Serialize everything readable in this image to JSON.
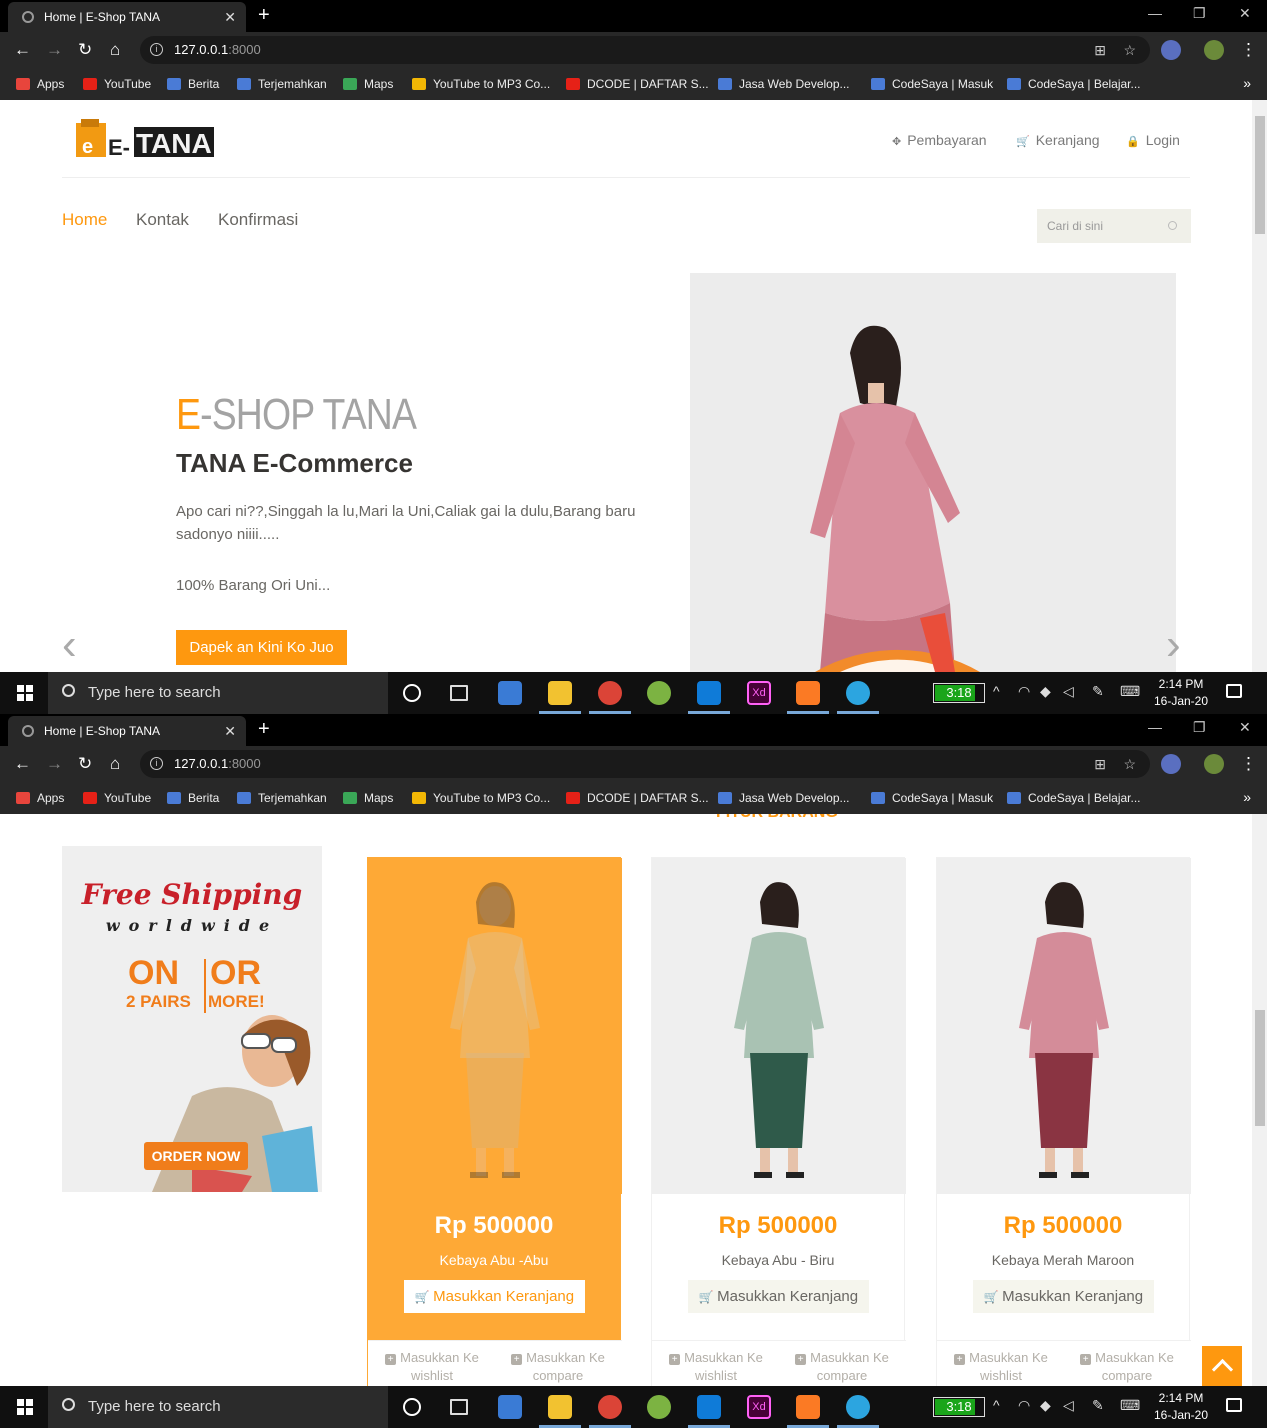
{
  "browser": {
    "tab_title": "Home | E-Shop TANA",
    "tab_close": "✕",
    "new_tab": "+",
    "url_host": "127.0.0.1",
    "url_port": ":8000",
    "bookmarks": [
      {
        "label": "Apps",
        "color": "#e8453c"
      },
      {
        "label": "YouTube",
        "color": "#e62117"
      },
      {
        "label": "Berita",
        "color": "#4a7bd6"
      },
      {
        "label": "Terjemahkan",
        "color": "#4a7bd6"
      },
      {
        "label": "Maps",
        "color": "#3aa757"
      },
      {
        "label": "YouTube to MP3 Co...",
        "color": "#f2b705"
      },
      {
        "label": "DCODE | DAFTAR S...",
        "color": "#e62117"
      },
      {
        "label": "Jasa Web Develop...",
        "color": "#4a7bd6"
      },
      {
        "label": "CodeSaya | Masuk",
        "color": "#4a7bd6"
      },
      {
        "label": "CodeSaya | Belajar...",
        "color": "#4a7bd6"
      }
    ],
    "more": "»"
  },
  "header": {
    "links": [
      {
        "icon": "crosshair-icon",
        "glyph": "✥",
        "label": "Pembayaran"
      },
      {
        "icon": "cart-icon",
        "glyph": "🛒",
        "label": "Keranjang"
      },
      {
        "icon": "lock-icon",
        "glyph": "🔒",
        "label": "Login"
      }
    ],
    "nav": [
      {
        "label": "Home",
        "active": true
      },
      {
        "label": "Kontak",
        "active": false
      },
      {
        "label": "Konfirmasi",
        "active": false
      }
    ],
    "search_placeholder": "Cari di sini"
  },
  "hero": {
    "title_e": "E",
    "title_rest": "-SHOP TANA",
    "subtitle": "TANA E-Commerce",
    "paragraph": "Apo cari ni??,Singgah la lu,Mari la Uni,Caliak gai la dulu,Barang baru sadonyo niiii.....",
    "paragraph2": "100% Barang Ori Uni...",
    "button": "Dapek an Kini Ko Juo",
    "prev": "‹",
    "next": "›"
  },
  "features": {
    "heading": "FITUR BARANG",
    "banner": {
      "free_shipping": "Free Shipping",
      "worldwide": "worldwide",
      "on": "ON",
      "or": "OR",
      "pairs": "2 PAIRS",
      "more": "MORE!",
      "order": "ORDER NOW"
    },
    "products": [
      {
        "price": "Rp 500000",
        "name": "Kebaya Abu -Abu",
        "button": "Masukkan Keranjang",
        "wishlist": "Masukkan Ke wishlist",
        "compare": "Masukkan Ke compare",
        "highlighted": true,
        "dress": "#d9c8a8",
        "skirt": "#cdb896"
      },
      {
        "price": "Rp 500000",
        "name": "Kebaya Abu - Biru",
        "button": "Masukkan Keranjang",
        "wishlist": "Masukkan Ke wishlist",
        "compare": "Masukkan Ke compare",
        "highlighted": false,
        "dress": "#a9c2b3",
        "skirt": "#2f5a4a"
      },
      {
        "price": "Rp 500000",
        "name": "Kebaya Merah Maroon",
        "button": "Masukkan Keranjang",
        "wishlist": "Masukkan Ke wishlist",
        "compare": "Masukkan Ke compare",
        "highlighted": false,
        "dress": "#d48c99",
        "skirt": "#8a3442"
      }
    ]
  },
  "taskbar": {
    "search_placeholder": "Type here to search",
    "battery": "3:18",
    "battery_level": 0.8,
    "time": "2:14 PM",
    "date": "16-Jan-20"
  },
  "colors": {
    "accent": "#fe980f"
  }
}
